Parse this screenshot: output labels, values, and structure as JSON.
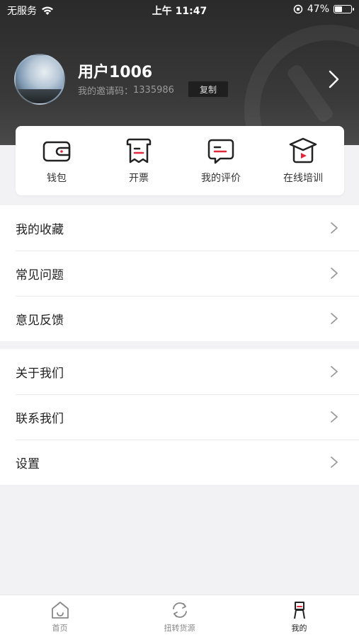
{
  "status_bar": {
    "carrier": "无服务",
    "time": "上午 11:47",
    "battery": "47%",
    "battery_level": 0.47
  },
  "profile": {
    "username": "用户1006",
    "invite_label": "我的邀请码：",
    "invite_code": "1335986",
    "copy_label": "复制"
  },
  "quick_actions": [
    {
      "label": "钱包",
      "icon": "wallet-icon"
    },
    {
      "label": "开票",
      "icon": "invoice-icon"
    },
    {
      "label": "我的评价",
      "icon": "review-icon"
    },
    {
      "label": "在线培训",
      "icon": "training-icon"
    }
  ],
  "menu_group_1": [
    {
      "label": "我的收藏"
    },
    {
      "label": "常见问题"
    },
    {
      "label": "意见反馈"
    }
  ],
  "menu_group_2": [
    {
      "label": "关于我们"
    },
    {
      "label": "联系我们"
    },
    {
      "label": "设置"
    }
  ],
  "tabbar": [
    {
      "label": "首页",
      "icon": "home-icon"
    },
    {
      "label": "扭转货源",
      "icon": "refresh-icon"
    },
    {
      "label": "我的",
      "icon": "profile-icon",
      "active": true
    }
  ],
  "colors": {
    "accent": "#e0283a",
    "header_bg": "#2f2f2f"
  }
}
